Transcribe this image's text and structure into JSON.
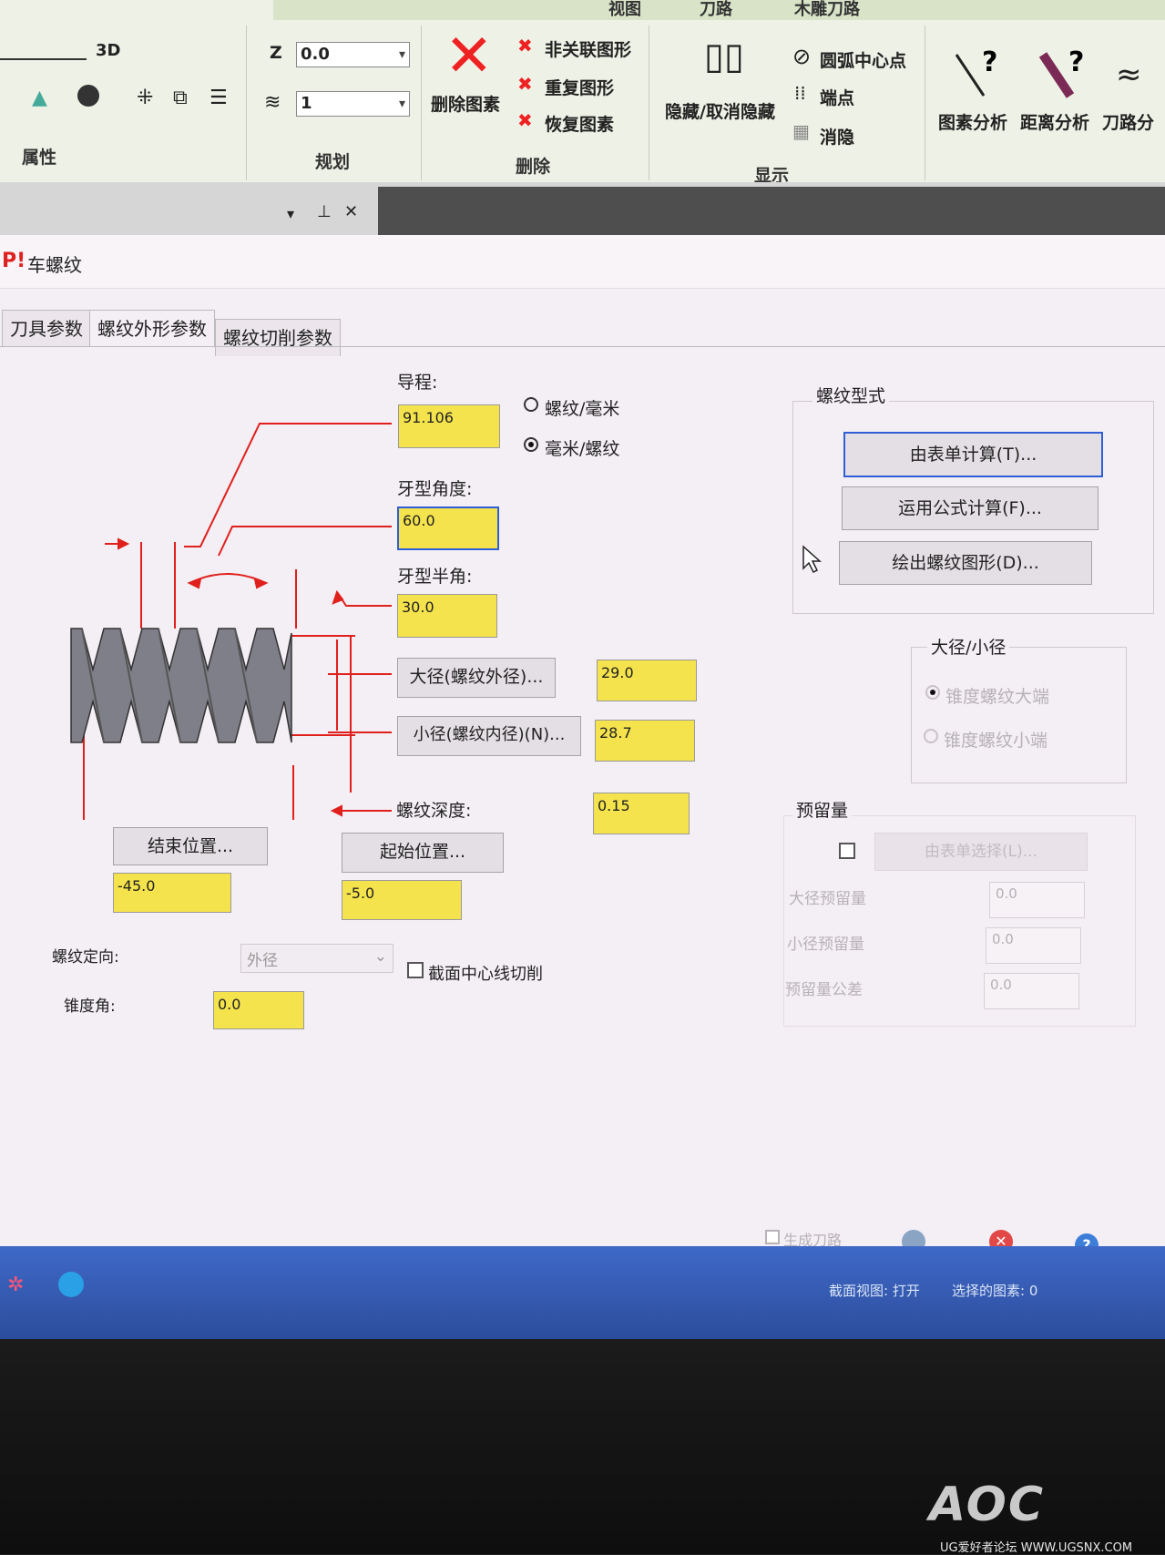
{
  "ribbon": {
    "tabs": [
      "视图",
      "刀路",
      "木雕刀路"
    ],
    "properties": {
      "group_label": "属性",
      "line_mode": "3D"
    },
    "plan": {
      "group_label": "规划",
      "z_label": "Z",
      "z_value": "0.0",
      "layer_value": "1"
    },
    "delete": {
      "group_label": "删除",
      "delete_entity": "删除图素",
      "non_assoc": "非关联图形",
      "duplicate": "重复图形",
      "restore": "恢复图素"
    },
    "display": {
      "group_label": "显示",
      "hide_unhide": "隐藏/取消隐藏",
      "center_point": "圆弧中心点",
      "endpoint": "端点",
      "blank": "消隐"
    },
    "analysis": {
      "entity_analysis": "图素分析",
      "distance_analysis": "距离分析",
      "toolpath_analysis": "刀路分"
    }
  },
  "dialog": {
    "title": "车螺纹",
    "tabs": [
      "刀具参数",
      "螺纹外形参数",
      "螺纹切削参数"
    ],
    "lead": {
      "label": "导程:",
      "value": "91.106",
      "unit_options": [
        "螺纹/毫米",
        "毫米/螺纹"
      ],
      "unit_selected": "毫米/螺纹"
    },
    "included_angle": {
      "label": "牙型角度:",
      "value": "60.0"
    },
    "half_angle": {
      "label": "牙型半角:",
      "value": "30.0"
    },
    "major_diameter": {
      "button": "大径(螺纹外径)...",
      "value": "29.0"
    },
    "minor_diameter": {
      "button": "小径(螺纹内径)(N)...",
      "value": "28.7"
    },
    "thread_depth": {
      "label": "螺纹深度:",
      "value": "0.15"
    },
    "end_position": {
      "button": "结束位置...",
      "value": "-45.0"
    },
    "start_position": {
      "button": "起始位置...",
      "value": "-5.0"
    },
    "thread_orientation": {
      "label": "螺纹定向:",
      "value": "外径"
    },
    "section_centerline": {
      "label": "截面中心线切削"
    },
    "taper_angle": {
      "label": "锥度角:",
      "value": "0.0"
    },
    "thread_form": {
      "group_label": "螺纹型式",
      "from_table": "由表单计算(T)...",
      "formula": "运用公式计算(F)...",
      "draw": "绘出螺纹图形(D)..."
    },
    "major_minor": {
      "group_label": "大径/小径",
      "options": [
        "锥度螺纹大端",
        "锥度螺纹小端"
      ]
    },
    "allowance": {
      "group_label": "预留量",
      "select_button": "由表单选择(L)...",
      "major_label": "大径预留量",
      "major_value": "0.0",
      "minor_label": "小径预留量",
      "minor_value": "0.0",
      "tolerance_label": "预留量公差",
      "tolerance_value": "0.0"
    },
    "generate_toolpath": "生成刀路"
  },
  "statusbar": {
    "section_view": "截面视图: 打开",
    "selected": "选择的图素: 0"
  },
  "bottom": {
    "brand": "AOC",
    "watermark": "UG爱好者论坛 WWW.UGSNX.COM"
  },
  "colors": {
    "field_yellow": "#f4e34c",
    "dim_red": "#e0201c",
    "dialog_bg": "#f4eef5",
    "accent_blue": "#2f5fd6"
  }
}
